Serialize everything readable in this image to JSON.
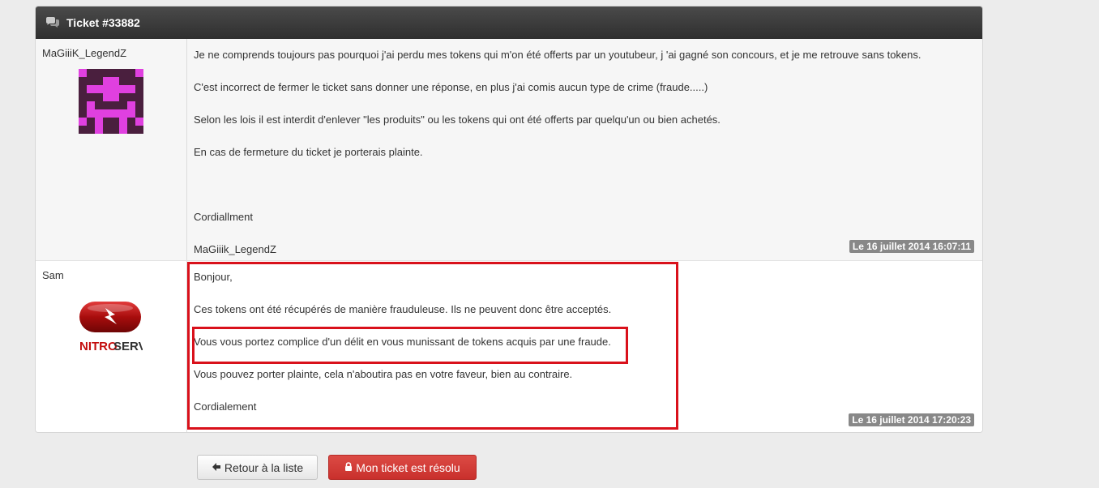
{
  "ticket": {
    "title": "Ticket #33882"
  },
  "messages": [
    {
      "author": "MaGiiiK_LegendZ",
      "lines": [
        "Je ne comprends toujours pas pourquoi j'ai perdu mes tokens qui m'on été offerts par un youtubeur, j 'ai gagné son concours, et je me retrouve sans tokens.",
        "C'est incorrect de fermer le ticket sans donner une réponse, en plus j'ai comis aucun type de crime (fraude.....)",
        "Selon les lois il est interdit d'enlever \"les produits\" ou les tokens qui ont été offerts par quelqu'un ou bien achetés.",
        "En cas de fermeture du ticket je porterais plainte.",
        "Cordiallment",
        "MaGiiik_LegendZ"
      ],
      "date": "Le 16 juillet 2014 16:07:11"
    },
    {
      "author": "Sam",
      "avatar_label": {
        "part1": "NITRO",
        "part2": "SERV"
      },
      "lines": [
        "Bonjour,",
        "Ces tokens ont été récupérés de manière frauduleuse. Ils ne peuvent donc être acceptés.",
        "Vous vous portez complice d'un délit en vous munissant de tokens acquis par une fraude.",
        "Vous pouvez porter plainte, cela n'aboutira pas en votre faveur, bien au contraire.",
        "Cordialement"
      ],
      "date": "Le 16 juillet 2014 17:20:23"
    }
  ],
  "buttons": {
    "back_label": "Retour à la liste",
    "back_icon": "arrow-left-icon",
    "resolve_label": "Mon ticket est résolu",
    "resolve_icon": "lock-icon"
  },
  "colors": {
    "header_bg": "#333333",
    "highlight": "#d9111b",
    "danger": "#d9534f",
    "avatar_magenta": "#e040e0",
    "avatar_purple": "#4a1f3e"
  }
}
